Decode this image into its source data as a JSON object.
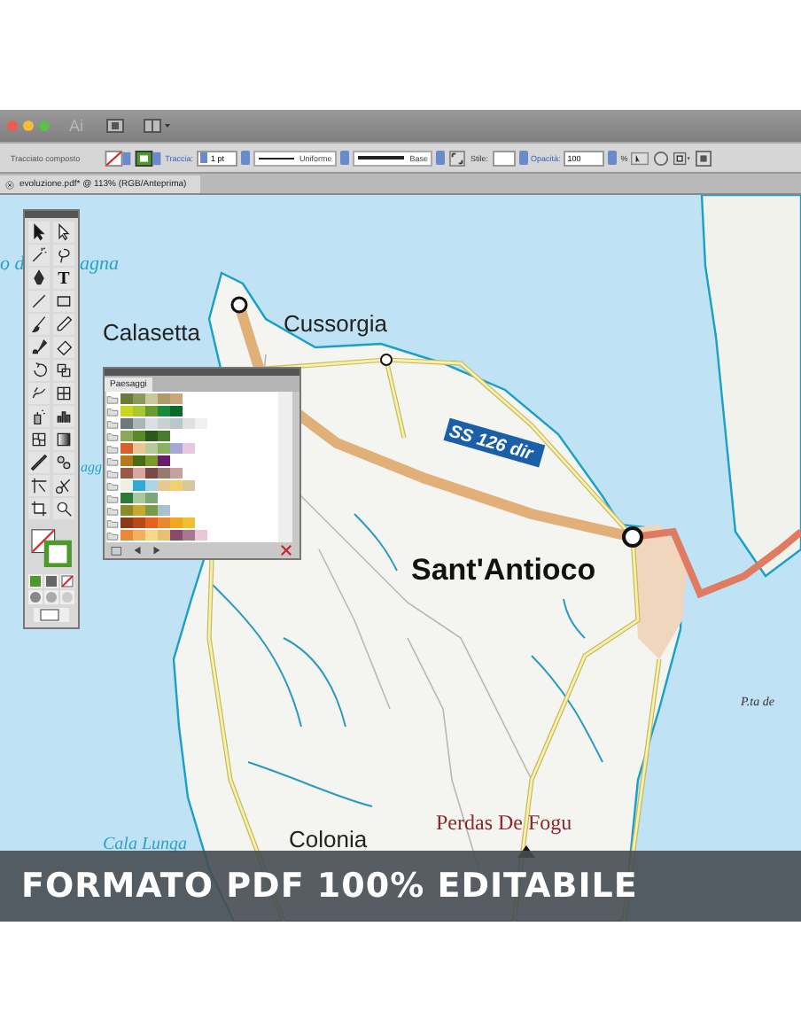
{
  "app_bar": {
    "app_label": "Ai"
  },
  "control_bar": {
    "object_type": "Tracciato composto",
    "stroke_label": "Traccia:",
    "stroke_weight": "1 pt",
    "profile": "Uniforme",
    "brush": "Base",
    "style_label": "Stile:",
    "opacity_label": "Opacità:",
    "opacity": "100",
    "opacity_unit": "%"
  },
  "document_tab": {
    "title": "evoluzione.pdf* @ 113% (RGB/Anteprima)"
  },
  "tools": [
    {
      "kind": "arrow"
    },
    {
      "kind": "hollow-arrow"
    },
    {
      "kind": "wand"
    },
    {
      "kind": "lasso"
    },
    {
      "kind": "pen"
    },
    {
      "kind": "type",
      "label": "T"
    },
    {
      "kind": "line"
    },
    {
      "kind": "rect"
    },
    {
      "kind": "brush"
    },
    {
      "kind": "pencil"
    },
    {
      "kind": "blob"
    },
    {
      "kind": "eraser"
    },
    {
      "kind": "rotate"
    },
    {
      "kind": "scale"
    },
    {
      "kind": "warp"
    },
    {
      "kind": "transform"
    },
    {
      "kind": "spray"
    },
    {
      "kind": "graph"
    },
    {
      "kind": "mesh"
    },
    {
      "kind": "gradient"
    },
    {
      "kind": "eyedropper"
    },
    {
      "kind": "blend"
    },
    {
      "kind": "slice"
    },
    {
      "kind": "scissors"
    },
    {
      "kind": "artboard"
    },
    {
      "kind": "zoom"
    }
  ],
  "swatch_panel": {
    "tab": "Paesaggi",
    "groups": [
      {
        "swatches": [
          {
            "color": "#6b7a3a"
          },
          {
            "color": "#8a9a5b"
          },
          {
            "color": "#c8c89a"
          },
          {
            "color": "#b09a6a"
          },
          {
            "color": "#c8a878"
          }
        ]
      },
      {
        "swatches": [
          {
            "color": "#c8d820"
          },
          {
            "color": "#a8c830"
          },
          {
            "color": "#6a9a30"
          },
          {
            "color": "#1a8a3a"
          },
          {
            "color": "#0a6a2a"
          }
        ]
      },
      {
        "swatches": [
          {
            "color": "#6a7a7a"
          },
          {
            "color": "#a8b8b8"
          },
          {
            "color": "#d8e0e0"
          },
          {
            "color": "#c8d0d0"
          },
          {
            "color": "#b8c8c8"
          },
          {
            "color": "#e0e0e0"
          },
          {
            "color": "#f0f0f0"
          }
        ]
      },
      {
        "swatches": [
          {
            "color": "#8aa858"
          },
          {
            "color": "#5a8a28"
          },
          {
            "color": "#2a5a18"
          },
          {
            "color": "#4a7a30"
          }
        ]
      },
      {
        "swatches": [
          {
            "color": "#d86030"
          },
          {
            "color": "#e8c890"
          },
          {
            "color": "#b8c8a0"
          },
          {
            "color": "#8ab060"
          },
          {
            "color": "#a8a8d8"
          },
          {
            "color": "#e8c8e0"
          }
        ]
      },
      {
        "swatches": [
          {
            "color": "#b87a18"
          },
          {
            "color": "#4a6a18"
          },
          {
            "color": "#7a9a28"
          },
          {
            "color": "#6a1a6a"
          }
        ]
      },
      {
        "swatches": [
          {
            "color": "#9a5a48"
          },
          {
            "color": "#d8a8a0"
          },
          {
            "color": "#7a4a48"
          },
          {
            "color": "#9a7a70"
          },
          {
            "color": "#c8a0a0"
          }
        ]
      },
      {
        "swatches": [
          {
            "color": "#f0f0e0"
          },
          {
            "color": "#30a8d8"
          },
          {
            "color": "#a8d8e8"
          },
          {
            "color": "#e8c890"
          },
          {
            "color": "#f0d070"
          },
          {
            "color": "#d8c8a0"
          }
        ]
      },
      {
        "swatches": [
          {
            "color": "#2a7a3a"
          },
          {
            "color": "#a8c8a0"
          },
          {
            "color": "#7aa878"
          }
        ]
      },
      {
        "swatches": [
          {
            "color": "#8a8a28"
          },
          {
            "color": "#c8a830"
          },
          {
            "color": "#7a9a48"
          },
          {
            "color": "#a8c0d0"
          }
        ]
      },
      {
        "swatches": [
          {
            "color": "#8a3a18"
          },
          {
            "color": "#b84a18"
          },
          {
            "color": "#e86020"
          },
          {
            "color": "#e88830"
          },
          {
            "color": "#f0a820"
          },
          {
            "color": "#f0c030"
          }
        ]
      },
      {
        "swatches": [
          {
            "color": "#e88838"
          },
          {
            "color": "#f0b060"
          },
          {
            "color": "#f8d888"
          },
          {
            "color": "#e8c070"
          },
          {
            "color": "#8a4a6a"
          },
          {
            "color": "#a87890"
          },
          {
            "color": "#e8c8d8"
          }
        ]
      }
    ]
  },
  "map_labels": [
    {
      "kind": "sea",
      "text": "o d"
    },
    {
      "kind": "sea",
      "text": "agna"
    },
    {
      "kind": "sea",
      "text": "agg"
    },
    {
      "kind": "town",
      "text": "Calasetta"
    },
    {
      "kind": "town",
      "text": "Cussorgia"
    },
    {
      "kind": "city",
      "text": "Sant'Antioco"
    },
    {
      "kind": "road",
      "text": "SS 126 dir"
    },
    {
      "kind": "cape",
      "text": "P.ta de"
    },
    {
      "kind": "peak",
      "text": "Perdas De Fogu"
    },
    {
      "kind": "town",
      "text": "Colonia"
    },
    {
      "kind": "sea",
      "text": "Cala Lunga"
    }
  ],
  "banner": {
    "text": "FORMATO PDF 100% EDITABILE"
  }
}
